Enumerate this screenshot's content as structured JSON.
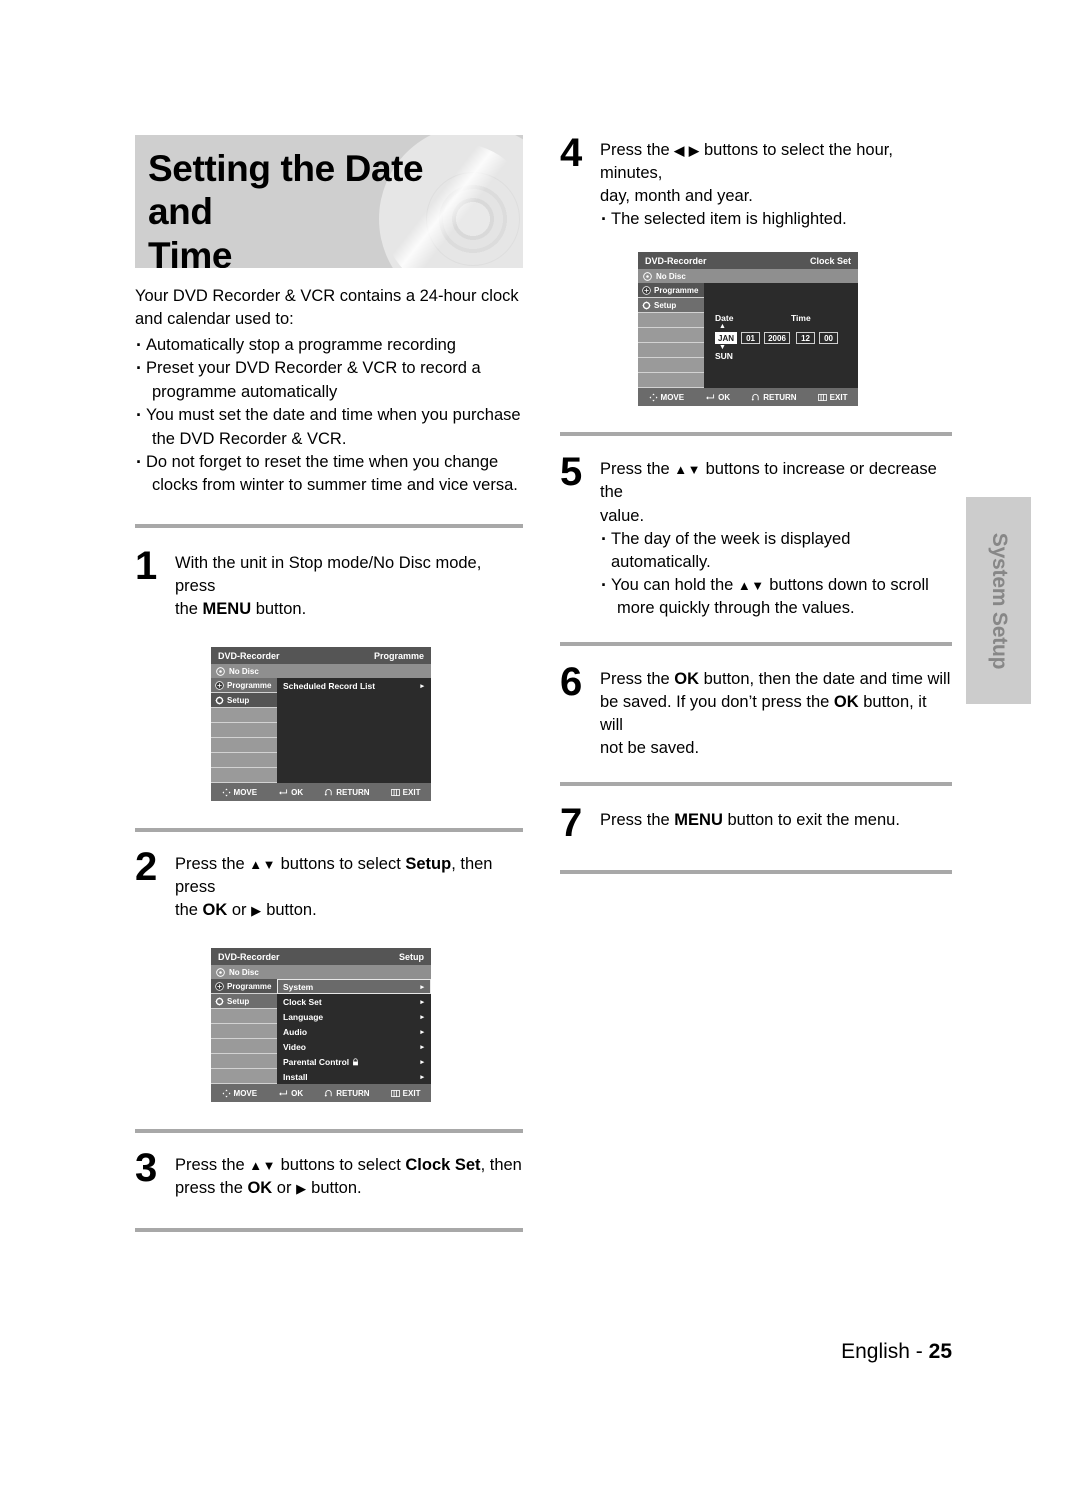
{
  "page": {
    "title": "Setting the Date and Time",
    "title_line1": "Setting the Date and",
    "title_line2": "Time",
    "side_tab": "System Setup",
    "footer_language": "English - ",
    "footer_page": "25"
  },
  "intro": {
    "line1": "Your DVD Recorder & VCR contains a 24-hour clock",
    "line2": "and calendar used to:",
    "bullets": [
      {
        "text": "Automatically stop a programme recording",
        "cont": ""
      },
      {
        "text": "Preset your DVD Recorder & VCR to record a",
        "cont": "programme automatically"
      },
      {
        "text": "You must set the date and time when you purchase",
        "cont": "the DVD Recorder & VCR."
      },
      {
        "text": "Do not forget to reset the time when you change",
        "cont": "clocks from winter to summer time and vice versa."
      }
    ]
  },
  "steps": {
    "step1": {
      "number": "1",
      "line1_a": "With the unit in Stop mode/No Disc mode, press",
      "line2_a": "the ",
      "line2_b": "MENU",
      "line2_c": " button."
    },
    "step2": {
      "number": "2",
      "line1_a": "Press the ",
      "line1_arrows": "▲▼",
      "line1_b": " buttons to select ",
      "line1_c": "Setup",
      "line1_d": ", then press",
      "line2_a": "the ",
      "line2_b": "OK",
      "line2_c": " or ",
      "line2_arrow": "▶",
      "line2_d": " button."
    },
    "step3": {
      "number": "3",
      "line1_a": "Press the ",
      "line1_arrows": "▲▼",
      "line1_b": " buttons to select ",
      "line1_c": "Clock Set",
      "line1_d": ", then",
      "line2_a": "press the ",
      "line2_b": "OK",
      "line2_c": " or ",
      "line2_arrow": "▶",
      "line2_d": " button."
    },
    "step4": {
      "number": "4",
      "line1_a": "Press the ",
      "line1_arrows": "◀ ▶",
      "line1_b": " buttons to select the hour, minutes,",
      "line2": "day, month and year.",
      "bullet1": "The selected item is highlighted."
    },
    "step5": {
      "number": "5",
      "line1_a": "Press the ",
      "line1_arrows": "▲▼",
      "line1_b": " buttons to increase or decrease the",
      "line2": "value.",
      "bullet1": "The day of the week is displayed automatically.",
      "bullet2_a": "You can hold the ",
      "bullet2_arrows": "▲▼",
      "bullet2_b": " buttons down to scroll",
      "bullet2_cont": "more quickly through the values."
    },
    "step6": {
      "number": "6",
      "line1_a": "Press the ",
      "line1_b": "OK",
      "line1_c": " button, then the date and time will",
      "line2_a": "be saved. If you don’t press the ",
      "line2_b": "OK",
      "line2_c": " button, it will",
      "line3": "not be saved."
    },
    "step7": {
      "number": "7",
      "line1_a": "Press the ",
      "line1_b": "MENU",
      "line1_c": " button to exit the menu."
    }
  },
  "osd": {
    "common": {
      "brand": "DVD-Recorder",
      "disc_status": "No Disc",
      "side_programme": "Programme",
      "side_setup": "Setup",
      "bottom_move": "MOVE",
      "bottom_ok": "OK",
      "bottom_return": "RETURN",
      "bottom_exit": "EXIT"
    },
    "programme_screen": {
      "header_right": "Programme",
      "rows": [
        {
          "label": "Scheduled Record List",
          "caret": "▸"
        }
      ]
    },
    "setup_screen": {
      "header_right": "Setup",
      "rows": [
        {
          "label": "System",
          "caret": "▸",
          "highlighted": true,
          "lock": false
        },
        {
          "label": "Clock Set",
          "caret": "▸",
          "highlighted": false,
          "lock": false
        },
        {
          "label": "Language",
          "caret": "▸",
          "highlighted": false,
          "lock": false
        },
        {
          "label": "Audio",
          "caret": "▸",
          "highlighted": false,
          "lock": false
        },
        {
          "label": "Video",
          "caret": "▸",
          "highlighted": false,
          "lock": false
        },
        {
          "label": "Parental Control",
          "caret": "▸",
          "highlighted": false,
          "lock": true
        },
        {
          "label": "Install",
          "caret": "▸",
          "highlighted": false,
          "lock": false
        }
      ]
    },
    "clock_screen": {
      "header_right": "Clock Set",
      "label_date": "Date",
      "label_time": "Time",
      "field_month": "JAN",
      "field_day": "01",
      "field_year": "2006",
      "field_hour": "12",
      "field_minute": "00",
      "weekday": "SUN",
      "arrow_up": "▲",
      "arrow_down": "▼"
    }
  },
  "colors": {
    "banner_bg": "#cfcfcf",
    "divider": "#a8a8a8",
    "side_tab_bg": "#cccccc",
    "side_tab_text": "#878787",
    "osd_title_bar": "#555555",
    "osd_disc_bar": "#8f8f8f",
    "osd_side": "#9a9a9a",
    "osd_content": "#2b2b2b",
    "osd_bottom_bar": "#6b6b6b"
  }
}
